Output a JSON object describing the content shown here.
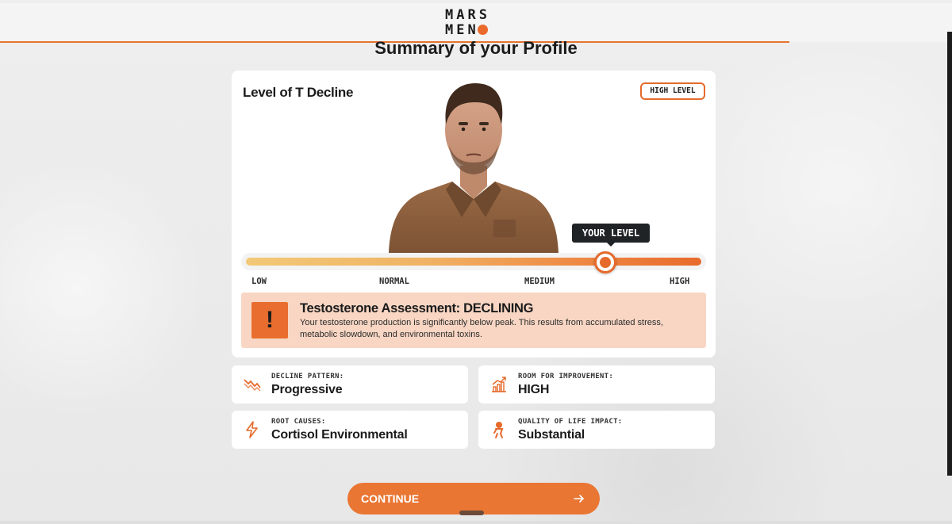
{
  "header": {
    "logo_line1": "MARS",
    "logo_line2": "MEN"
  },
  "page": {
    "title": "Summary of your Profile"
  },
  "card": {
    "title": "Level of T Decline",
    "badge": "HIGH LEVEL",
    "tooltip": "YOUR LEVEL",
    "slider": {
      "value": 0.79,
      "ticks": [
        "LOW",
        "NORMAL",
        "MEDIUM",
        "HIGH"
      ]
    },
    "alert": {
      "icon": "exclamation-icon",
      "title": "Testosterone Assessment: DECLINING",
      "text": "Your testosterone production is significantly below peak. This results from accumulated stress, metabolic slowdown, and environmental toxins."
    }
  },
  "stats": [
    {
      "icon": "decline-zigzag-icon",
      "label": "DECLINE PATTERN:",
      "value": "Progressive"
    },
    {
      "icon": "growth-chart-icon",
      "label": "ROOM FOR IMPROVEMENT:",
      "value": "HIGH"
    },
    {
      "icon": "lightning-icon",
      "label": "ROOT CAUSES:",
      "value": "Cortisol Environmental"
    },
    {
      "icon": "person-icon",
      "label": "QUALITY OF LIFE IMPACT:",
      "value": "Substantial"
    }
  ],
  "continue_button": {
    "label": "CONTINUE",
    "icon": "arrow-right-icon"
  },
  "colors": {
    "accent": "#E86A2B",
    "alert_bg": "#F8D6C3",
    "tooltip_bg": "#1F2326"
  }
}
